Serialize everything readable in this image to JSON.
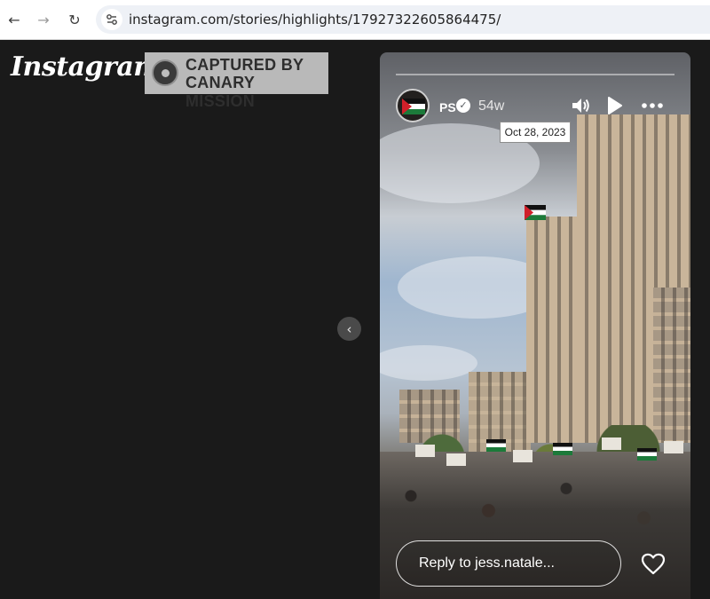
{
  "browser": {
    "url": "instagram.com/stories/highlights/17927322605864475/"
  },
  "brand": {
    "logo_text": "Instagram"
  },
  "watermark": {
    "line1": "CAPTURED BY",
    "line2": "CANARY MISSION"
  },
  "story": {
    "username": "PS",
    "verified": true,
    "time_ago": "54w",
    "date_tooltip": "Oct 28, 2023",
    "reply_placeholder": "Reply to jess.natale...",
    "icons": [
      "volume-icon",
      "play-icon",
      "more-icon",
      "heart-icon"
    ],
    "sticker": "palestinian-flag"
  },
  "colors": {
    "page_background": "#1a1a1a",
    "browser_bar": "#ffffff",
    "url_box": "#eef1f6",
    "watermark_background": "#b9b9b9"
  }
}
